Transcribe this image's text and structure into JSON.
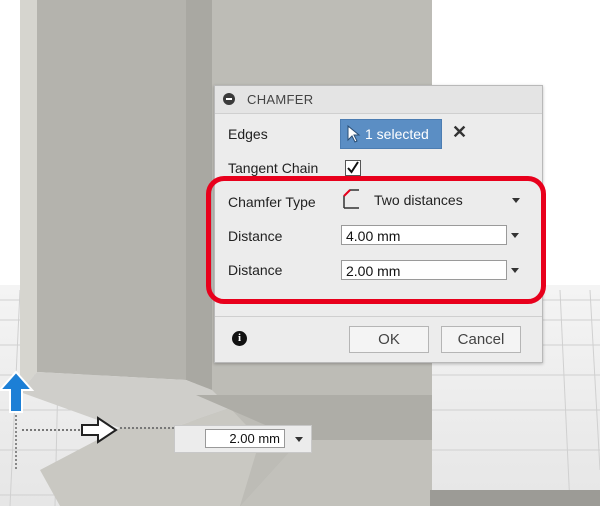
{
  "dialog": {
    "title": "CHAMFER",
    "edges_label": "Edges",
    "edges_selection": "1 selected",
    "tangent_chain_label": "Tangent Chain",
    "tangent_chain_checked": true,
    "chamfer_type_label": "Chamfer Type",
    "chamfer_type_value": "Two distances",
    "distance1_label": "Distance",
    "distance1_value": "4.00 mm",
    "distance2_label": "Distance",
    "distance2_value": "2.00 mm",
    "ok_label": "OK",
    "cancel_label": "Cancel"
  },
  "manipulator": {
    "value": "2.00 mm"
  },
  "colors": {
    "accent": "#5b8ec4",
    "highlight": "#e8001c",
    "arrow": "#1c7fd6"
  }
}
